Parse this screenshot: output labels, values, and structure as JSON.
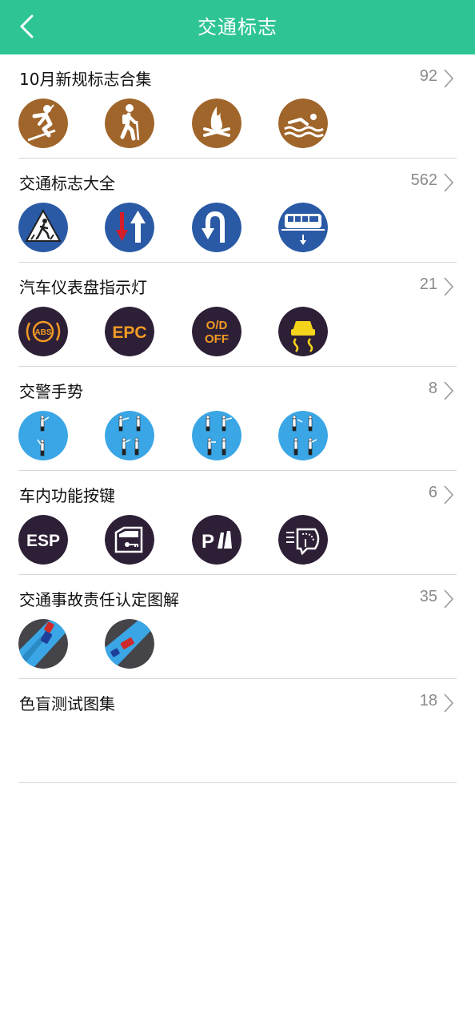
{
  "header": {
    "title": "交通标志"
  },
  "sections": [
    {
      "title": "10月新规标志合集",
      "count": "92"
    },
    {
      "title": "交通标志大全",
      "count": "562"
    },
    {
      "title": "汽车仪表盘指示灯",
      "count": "21"
    },
    {
      "title": "交警手势",
      "count": "8"
    },
    {
      "title": "车内功能按键",
      "count": "6"
    },
    {
      "title": "交通事故责任认定图解",
      "count": "35"
    },
    {
      "title": "色盲测试图集",
      "count": "18"
    }
  ],
  "icon_text": {
    "epc": "EPC",
    "od_top": "O/D",
    "od_bottom": "OFF",
    "esp": "ESP",
    "abs": "ABS",
    "park": "P"
  },
  "colors": {
    "header": "#2fc495",
    "brown": "#a0652a",
    "blue_sign": "#2a5aa5",
    "dash_dark": "#2d2036",
    "dash_orange": "#f39a25",
    "dash_yellow": "#f4d31b",
    "police_bg": "#3aa6e6"
  }
}
